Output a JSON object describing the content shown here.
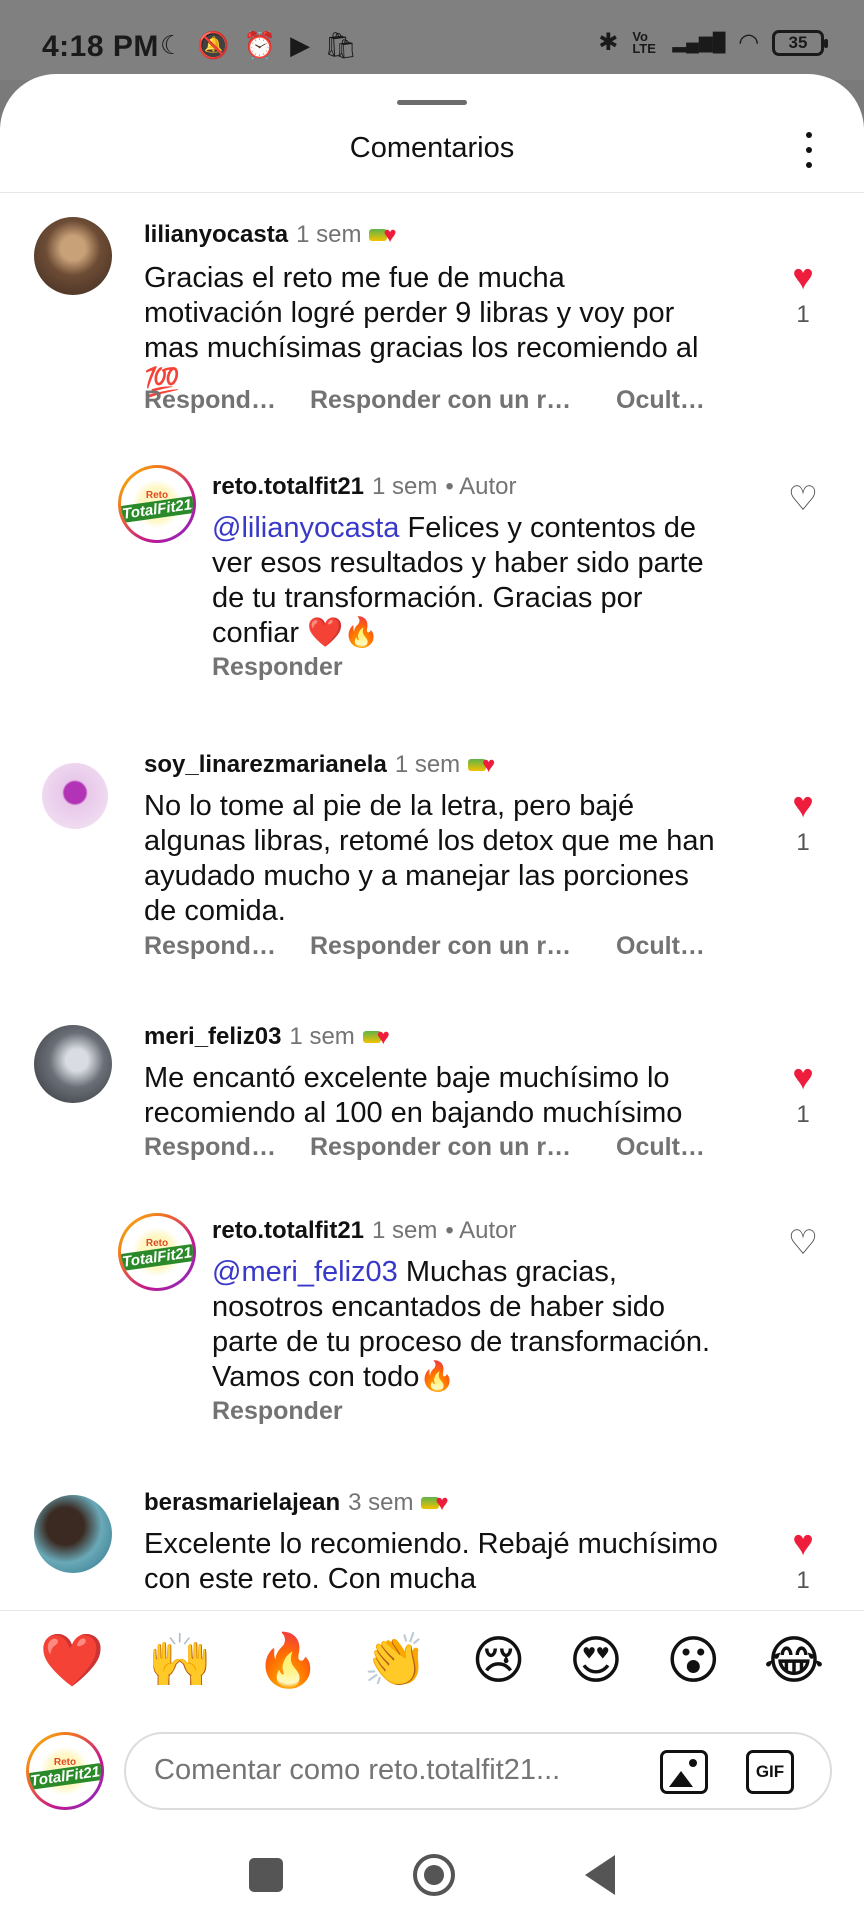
{
  "status_bar": {
    "time": "4:18 PM",
    "left_icons": [
      "moon-icon",
      "alarm-off-icon",
      "alarm-icon",
      "youtube-icon",
      "temu-icon"
    ],
    "left_glyphs": [
      "☾",
      "🔕",
      "⏰",
      "▶",
      "🛍"
    ],
    "right_icons": [
      "bluetooth-icon",
      "volte-icon",
      "signal-icon",
      "wifi-icon"
    ],
    "right_glyphs": [
      "✱",
      "Vo LTE",
      "▂▄▆█",
      "◠"
    ],
    "battery": "35"
  },
  "sheet": {
    "title": "Comentarios",
    "more_icon": "more-vertical-icon"
  },
  "comments": [
    {
      "username": "lilianyocasta",
      "time": "1 sem",
      "text": "Gracias el reto me fue de mucha motivación logré perder 9 libras y voy por mas muchísimas gracias los recomiendo al 💯",
      "actions": [
        "Respond…",
        "Responder con un r…",
        "Ocult…"
      ],
      "likes": "1",
      "liked": true
    },
    {
      "username": "reto.totalfit21",
      "time": "1 sem",
      "author": "• Autor",
      "mention": "@lilianyocasta",
      "text": " Felices y contentos de ver esos resultados y haber sido parte de tu transformación. Gracias por confiar ❤️🔥",
      "actions": [
        "Responder"
      ],
      "liked": false
    },
    {
      "username": "soy_linarezmarianela",
      "time": "1 sem",
      "text": "No lo tome al pie de la letra, pero bajé algunas libras, retomé los detox que me han ayudado mucho y a manejar las porciones de comida.",
      "actions": [
        "Respond…",
        "Responder con un r…",
        "Ocult…"
      ],
      "likes": "1",
      "liked": true
    },
    {
      "username": "meri_feliz03",
      "time": "1 sem",
      "text": "Me encantó excelente baje muchísimo lo recomiendo al 100 en bajando muchísimo",
      "actions": [
        "Respond…",
        "Responder con un r…",
        "Ocult…"
      ],
      "likes": "1",
      "liked": true
    },
    {
      "username": "reto.totalfit21",
      "time": "1 sem",
      "author": "• Autor",
      "mention": "@meri_feliz03",
      "text": " Muchas gracias, nosotros encantados de haber sido parte de tu proceso de transformación. Vamos con todo🔥",
      "actions": [
        "Responder"
      ],
      "liked": false
    },
    {
      "username": "berasmarielajean",
      "time": "3 sem",
      "text": "Excelente lo recomiendo. Rebajé muchísimo con este reto. Con mucha",
      "likes": "1",
      "liked": true
    }
  ],
  "brand_logo": {
    "line1": "Reto",
    "line2": "TotalFit21"
  },
  "reactions": [
    "❤️",
    "🙌",
    "🔥",
    "👏",
    "😢",
    "😍",
    "😮",
    "😂"
  ],
  "composer": {
    "placeholder": "Comentar como reto.totalfit21...",
    "image_icon": "image-icon",
    "gif_label": "GIF"
  },
  "nav": {
    "recents_icon": "recents-icon",
    "home_icon": "home-icon",
    "back_icon": "back-icon"
  },
  "colors": {
    "like_red": "#ee1d3c",
    "mention_blue": "#3838c9",
    "muted_text": "#737373"
  }
}
